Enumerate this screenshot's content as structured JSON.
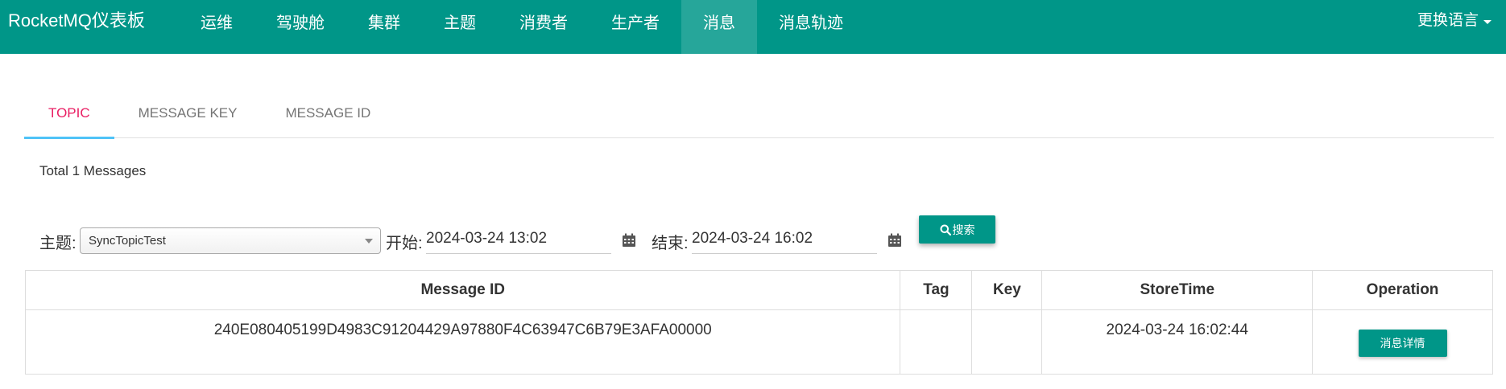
{
  "navbar": {
    "brand": "RocketMQ仪表板",
    "items": [
      {
        "label": "运维",
        "active": false
      },
      {
        "label": "驾驶舱",
        "active": false
      },
      {
        "label": "集群",
        "active": false
      },
      {
        "label": "主题",
        "active": false
      },
      {
        "label": "消费者",
        "active": false
      },
      {
        "label": "生产者",
        "active": false
      },
      {
        "label": "消息",
        "active": true
      },
      {
        "label": "消息轨迹",
        "active": false
      }
    ],
    "language": "更换语言"
  },
  "tabs": [
    {
      "label": "TOPIC",
      "active": true
    },
    {
      "label": "MESSAGE KEY",
      "active": false
    },
    {
      "label": "MESSAGE ID",
      "active": false
    }
  ],
  "total": "Total 1 Messages",
  "filter": {
    "topic_label": "主题:",
    "topic_value": "SyncTopicTest",
    "start_label": "开始:",
    "start_value": "2024-03-24 13:02",
    "end_label": "结束:",
    "end_value": "2024-03-24 16:02",
    "search_label": "搜索"
  },
  "icons": {
    "search": "search-icon",
    "calendar": "calendar-icon",
    "dropdown": "chevron-down-icon"
  },
  "colors": {
    "primary": "#009688",
    "nav_active": "#26a69a",
    "tab_active_text": "#e91e63",
    "tab_indicator": "#4fc3f7"
  },
  "table": {
    "columns": [
      "Message ID",
      "Tag",
      "Key",
      "StoreTime",
      "Operation"
    ],
    "rows": [
      {
        "message_id": "240E080405199D4983C91204429A97880F4C63947C6B79E3AFA00000",
        "tag": "",
        "key": "",
        "store_time": "2024-03-24 16:02:44",
        "operation": "消息详情"
      }
    ]
  }
}
